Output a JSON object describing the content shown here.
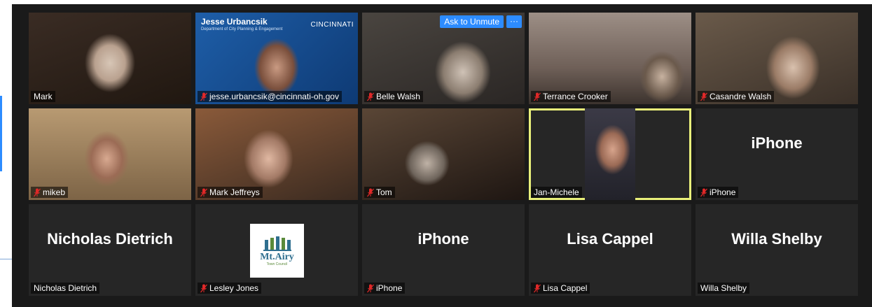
{
  "controls": {
    "ask_to_unmute": "Ask to Unmute",
    "more": "···"
  },
  "tiles": [
    {
      "name": "Mark",
      "muted": false
    },
    {
      "name": "jesse.urbancsik@cincinnati-oh.gov",
      "muted": true,
      "banner_title": "Jesse Urbancsik",
      "banner_sub": "Department of City Planning & Engagement",
      "banner_logo": "CINCINNATI"
    },
    {
      "name": "Belle Walsh",
      "muted": true
    },
    {
      "name": "Terrance Crooker",
      "muted": true
    },
    {
      "name": "Casandre Walsh",
      "muted": true
    },
    {
      "name": "mikeb",
      "muted": true
    },
    {
      "name": "Mark Jeffreys",
      "muted": true
    },
    {
      "name": "Tom",
      "muted": true
    },
    {
      "name": "Jan-Michele",
      "muted": false,
      "active_speaker": true
    },
    {
      "name": "iPhone",
      "muted": true,
      "display_name": "iPhone"
    },
    {
      "name": "Nicholas Dietrich",
      "muted": false,
      "display_name": "Nicholas Dietrich"
    },
    {
      "name": "Lesley Jones",
      "muted": true,
      "logo_text": "Mt.Airy",
      "logo_sub": "Town Council"
    },
    {
      "name": "iPhone",
      "muted": true,
      "display_name": "iPhone"
    },
    {
      "name": "Lisa Cappel",
      "muted": true,
      "display_name": "Lisa Cappel"
    },
    {
      "name": "Willa Shelby",
      "muted": false,
      "display_name": "Willa Shelby"
    }
  ],
  "colors": {
    "accent": "#2d8cff",
    "muted_icon": "#e02828",
    "active_border": "#e9f07a",
    "tile_bg": "#262626"
  }
}
